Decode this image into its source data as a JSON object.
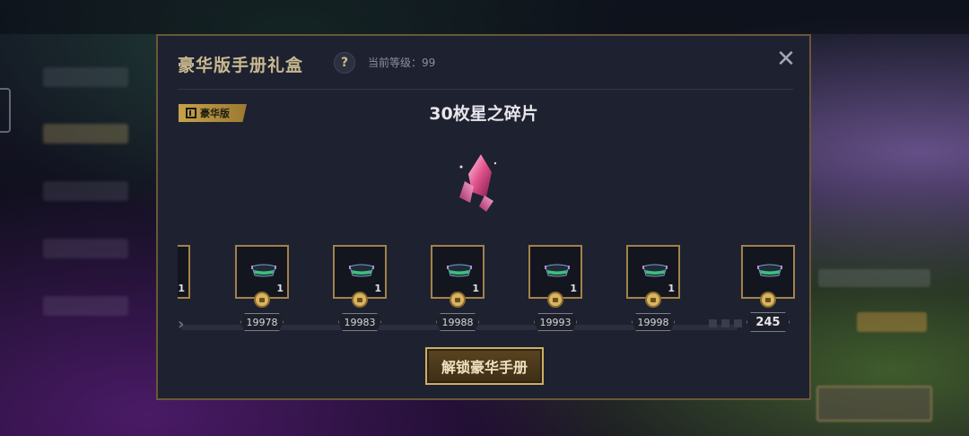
{
  "modal": {
    "title": "豪华版手册礼盒",
    "help_label": "?",
    "current_level": "当前等级：99",
    "close_label": "✕",
    "badge_label": "豪华版",
    "reward_title": "30枚星之碎片",
    "unlock_button": "解锁豪华手册"
  },
  "track": {
    "partial_item_qty": "1",
    "items": [
      {
        "level": "19978",
        "qty": "1",
        "icon": "chest-icon"
      },
      {
        "level": "19983",
        "qty": "1",
        "icon": "chest-icon"
      },
      {
        "level": "19988",
        "qty": "1",
        "icon": "chest-icon"
      },
      {
        "level": "19993",
        "qty": "1",
        "icon": "chest-icon"
      },
      {
        "level": "19998",
        "qty": "1",
        "icon": "chest-icon"
      }
    ],
    "final_item": {
      "level": "245",
      "qty": "",
      "icon": "chest-icon"
    }
  },
  "colors": {
    "accent_gold": "#c6a24a",
    "modal_bg": "#1e2130",
    "title": "#c8b98f"
  }
}
